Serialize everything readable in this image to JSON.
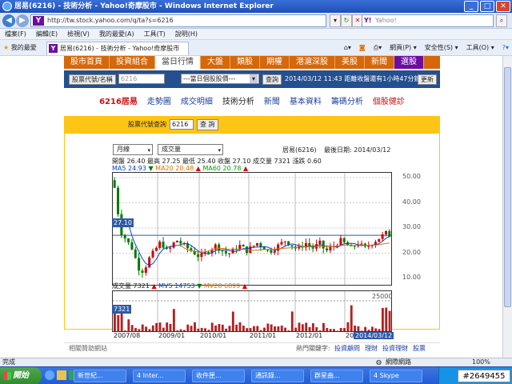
{
  "window": {
    "title": "居易(6216) - 技術分析 - Yahoo!奇摩股市 - Windows Internet Explorer"
  },
  "address": {
    "url": "http://tw.stock.yahoo.com/q/ta?s=6216",
    "search_placeholder": "Yahoo!"
  },
  "menu": [
    "檔案(F)",
    "編輯(E)",
    "檢視(V)",
    "我的最愛(A)",
    "工具(T)",
    "說明(H)"
  ],
  "favbar": {
    "favorites": "我的最愛",
    "tab_title": "居易(6216) - 技術分析 - Yahoo!奇摩股市",
    "tools": [
      "網頁(P) ▾",
      "安全性(S) ▾",
      "工具(O) ▾"
    ]
  },
  "site_nav": [
    "股市首頁",
    "投資組合",
    "當日行情",
    "大盤",
    "類股",
    "期權",
    "港滬深股",
    "美股",
    "新聞",
    "選股"
  ],
  "site_nav_active_index": 2,
  "quote_bar": {
    "code_label": "股票代號/名稱",
    "code_value": "6216",
    "dropdown": "---當日個股股價---",
    "query_btn": "查詢",
    "status": "2014/03/12 11:43 距離收盤還有1小時47分鐘",
    "refresh_btn": "更新"
  },
  "sub_nav": [
    "6216居易",
    "走勢圖",
    "成交明細",
    "技術分析",
    "新聞",
    "基本資料",
    "籌碼分析",
    "個股健診"
  ],
  "sub_nav_active_index": 3,
  "stock_query": {
    "label": "股票代號查詢",
    "value": "6216",
    "button": "查 詢"
  },
  "chart_controls": {
    "period": "月線",
    "indicator": "成交量"
  },
  "header": {
    "name": "居易(6216)",
    "date_label": "最後日期: 2014/03/12"
  },
  "ohlc": {
    "open_label": "開盤",
    "open": "26.40",
    "high_label": "最高",
    "high": "27.25",
    "low_label": "最低",
    "low": "25.40",
    "close_label": "收盤",
    "close": "27.10",
    "vol_label": "成交量",
    "vol": "7321",
    "chg_label": "漲跌",
    "chg": "0.60"
  },
  "ma": {
    "ma5_label": "MA5",
    "ma5": "24.93",
    "ma20_label": "MA20",
    "ma20": "20.48",
    "ma60_label": "MA60",
    "ma60": "20.78"
  },
  "vol_ma": {
    "vol_label": "成交量",
    "vol": "7321",
    "mv5_label": "MV5",
    "mv5": "14753",
    "mv20_label": "MV20",
    "mv20": "6899"
  },
  "colors": {
    "up": "#d10000",
    "down": "#007a00",
    "ma5": "#0046c8",
    "ma20": "#e07000",
    "ma60": "#00a000",
    "volume_bar": "#b41f1f"
  },
  "chart_data": {
    "type": "candlestick",
    "price_axis": {
      "ticks": [
        "50.00",
        "40.00",
        "30.00",
        "20.00",
        "10.00"
      ],
      "ylim": [
        10,
        50
      ],
      "current_label": "27.10"
    },
    "volume_axis": {
      "ticks": [
        "25000"
      ],
      "current_label": "7321"
    },
    "x_ticks": [
      "2007/08",
      "2009/01",
      "2010/01",
      "2011/01",
      "2012/01",
      "2013/01",
      "2014/03/12"
    ]
  },
  "footer": {
    "left": "相關贊助網站",
    "keywords_label": "熱門關鍵字:",
    "keywords": [
      "投資顧問",
      "理財",
      "投資理財",
      "股票"
    ]
  },
  "status": {
    "left": "完成",
    "zone": "網際網路",
    "zoom": "100%"
  },
  "taskbar": {
    "start": "開始",
    "tasks": [
      "新世紀...",
      "4 Inter...",
      "收件匣...",
      "通訊錄...",
      "群星曲...",
      "4 Skype"
    ],
    "badge": "#2649455"
  }
}
